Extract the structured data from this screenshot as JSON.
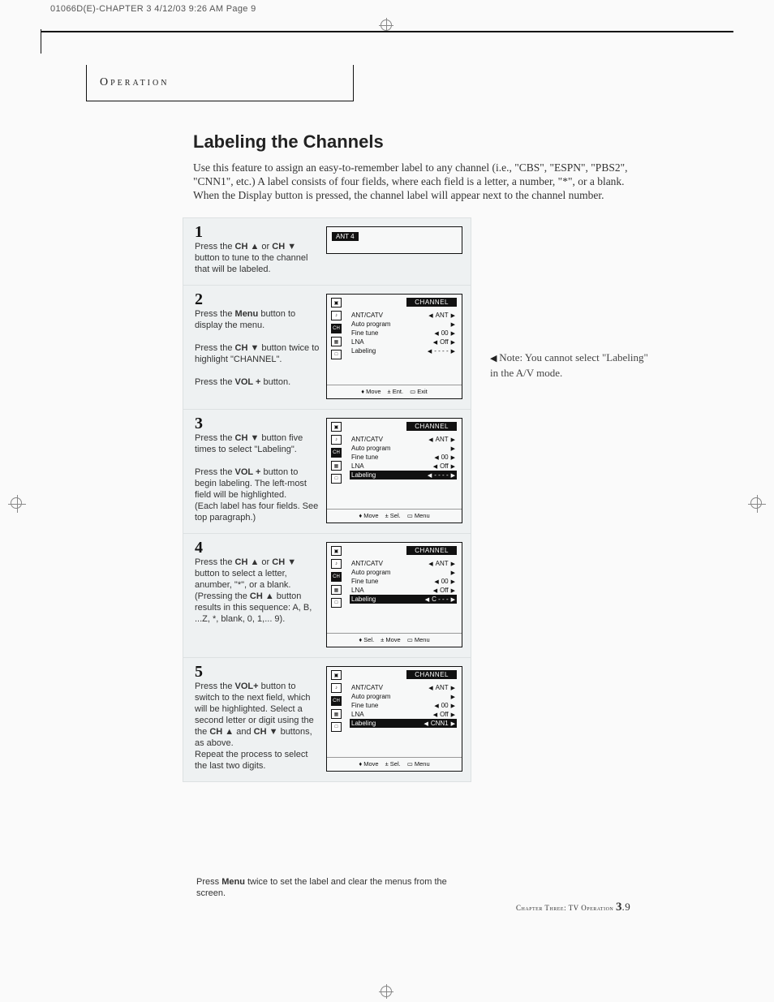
{
  "slug": "01066D(E)-CHAPTER 3  4/12/03  9:26 AM  Page 9",
  "section_header": "Operation",
  "title": "Labeling the Channels",
  "intro": "Use this feature to assign an easy-to-remember label to any channel (i.e., \"CBS\", \"ESPN\", \"PBS2\", \"CNN1\", etc.) A label consists of four fields, where each field is a letter, a number, \"*\", or a blank.  When the Display button is pressed, the channel label will appear next to the channel number.",
  "note": "Note: You cannot select \"Labeling\" in the A/V mode.",
  "closing_pre": "Press ",
  "closing_bold": "Menu",
  "closing_post": " twice to set the label and clear the menus from the screen.",
  "footer_left": "Chapter Three: TV Operation ",
  "footer_page_big": "3",
  "footer_page_dot": ".",
  "footer_page_small": "9",
  "steps": [
    {
      "num": "1",
      "html": "Press the <b>CH ▲</b> or <b>CH ▼</b> button to tune to the channel that will be labeled.",
      "osd_kind": "small",
      "osd_badge": "ANT 4"
    },
    {
      "num": "2",
      "html": "Press the <b>Menu</b> button to display the menu.<br><br>Press the <b>CH ▼</b> button twice to highlight \"CHANNEL\".<br><br>Press the <b>VOL +</b> button.",
      "osd_title": "CHANNEL",
      "sel_tab": 2,
      "rows": [
        {
          "label": "ANT/CATV",
          "val": "ANT",
          "arrows": "both"
        },
        {
          "label": "Auto program",
          "val": "",
          "arrows": "right"
        },
        {
          "label": "Fine tune",
          "val": "00",
          "arrows": "both"
        },
        {
          "label": "LNA",
          "val": "Off",
          "arrows": "both"
        },
        {
          "label": "Labeling",
          "val": "- - - -",
          "arrows": "both"
        }
      ],
      "foot": [
        "♦ Move",
        "± Ent.",
        "▭ Exit"
      ]
    },
    {
      "num": "3",
      "html": "Press the <b>CH ▼</b> button five times to select \"Labeling\".<br><br>Press the <b>VOL +</b> button to begin labeling. The left-most field will be highlighted.<br>(Each label has four fields. See top paragraph.)",
      "osd_title": "CHANNEL",
      "sel_tab": 2,
      "sel_row": 4,
      "rows": [
        {
          "label": "ANT/CATV",
          "val": "ANT",
          "arrows": "both"
        },
        {
          "label": "Auto program",
          "val": "",
          "arrows": "right"
        },
        {
          "label": "Fine tune",
          "val": "00",
          "arrows": "both"
        },
        {
          "label": "LNA",
          "val": "Off",
          "arrows": "both"
        },
        {
          "label": "Labeling",
          "val": "- - - -",
          "arrows": "both"
        }
      ],
      "foot": [
        "♦ Move",
        "± Sel.",
        "▭ Menu"
      ]
    },
    {
      "num": "4",
      "html": "Press the <b>CH ▲</b> or <b>CH ▼</b> button to select a letter, anumber, \"*\", or a blank. (Pressing the <b>CH ▲</b> button results in this sequence: A, B, ...Z, *, blank, 0, 1,... 9).",
      "osd_title": "CHANNEL",
      "sel_tab": 2,
      "sel_row": 4,
      "rows": [
        {
          "label": "ANT/CATV",
          "val": "ANT",
          "arrows": "both"
        },
        {
          "label": "Auto program",
          "val": "",
          "arrows": "right"
        },
        {
          "label": "Fine tune",
          "val": "00",
          "arrows": "both"
        },
        {
          "label": "LNA",
          "val": "Off",
          "arrows": "both"
        },
        {
          "label": "Labeling",
          "val": "C - - -",
          "arrows": "both"
        }
      ],
      "foot": [
        "♦ Sel.",
        "± Move",
        "▭ Menu"
      ]
    },
    {
      "num": "5",
      "html": "Press the <b>VOL+</b> button to switch to the next field, which will be highlighted. Select a second letter or digit using the the <b>CH ▲</b> and <b>CH ▼</b> buttons, as above.<br>Repeat the process to select the last two digits.",
      "osd_title": "CHANNEL",
      "sel_tab": 2,
      "sel_row": 4,
      "rows": [
        {
          "label": "ANT/CATV",
          "val": "ANT",
          "arrows": "both"
        },
        {
          "label": "Auto program",
          "val": "",
          "arrows": "right"
        },
        {
          "label": "Fine tune",
          "val": "00",
          "arrows": "both"
        },
        {
          "label": "LNA",
          "val": "Off",
          "arrows": "both"
        },
        {
          "label": "Labeling",
          "val": "CNN1",
          "arrows": "both"
        }
      ],
      "foot": [
        "♦ Move",
        "± Sel.",
        "▭ Menu"
      ]
    }
  ]
}
